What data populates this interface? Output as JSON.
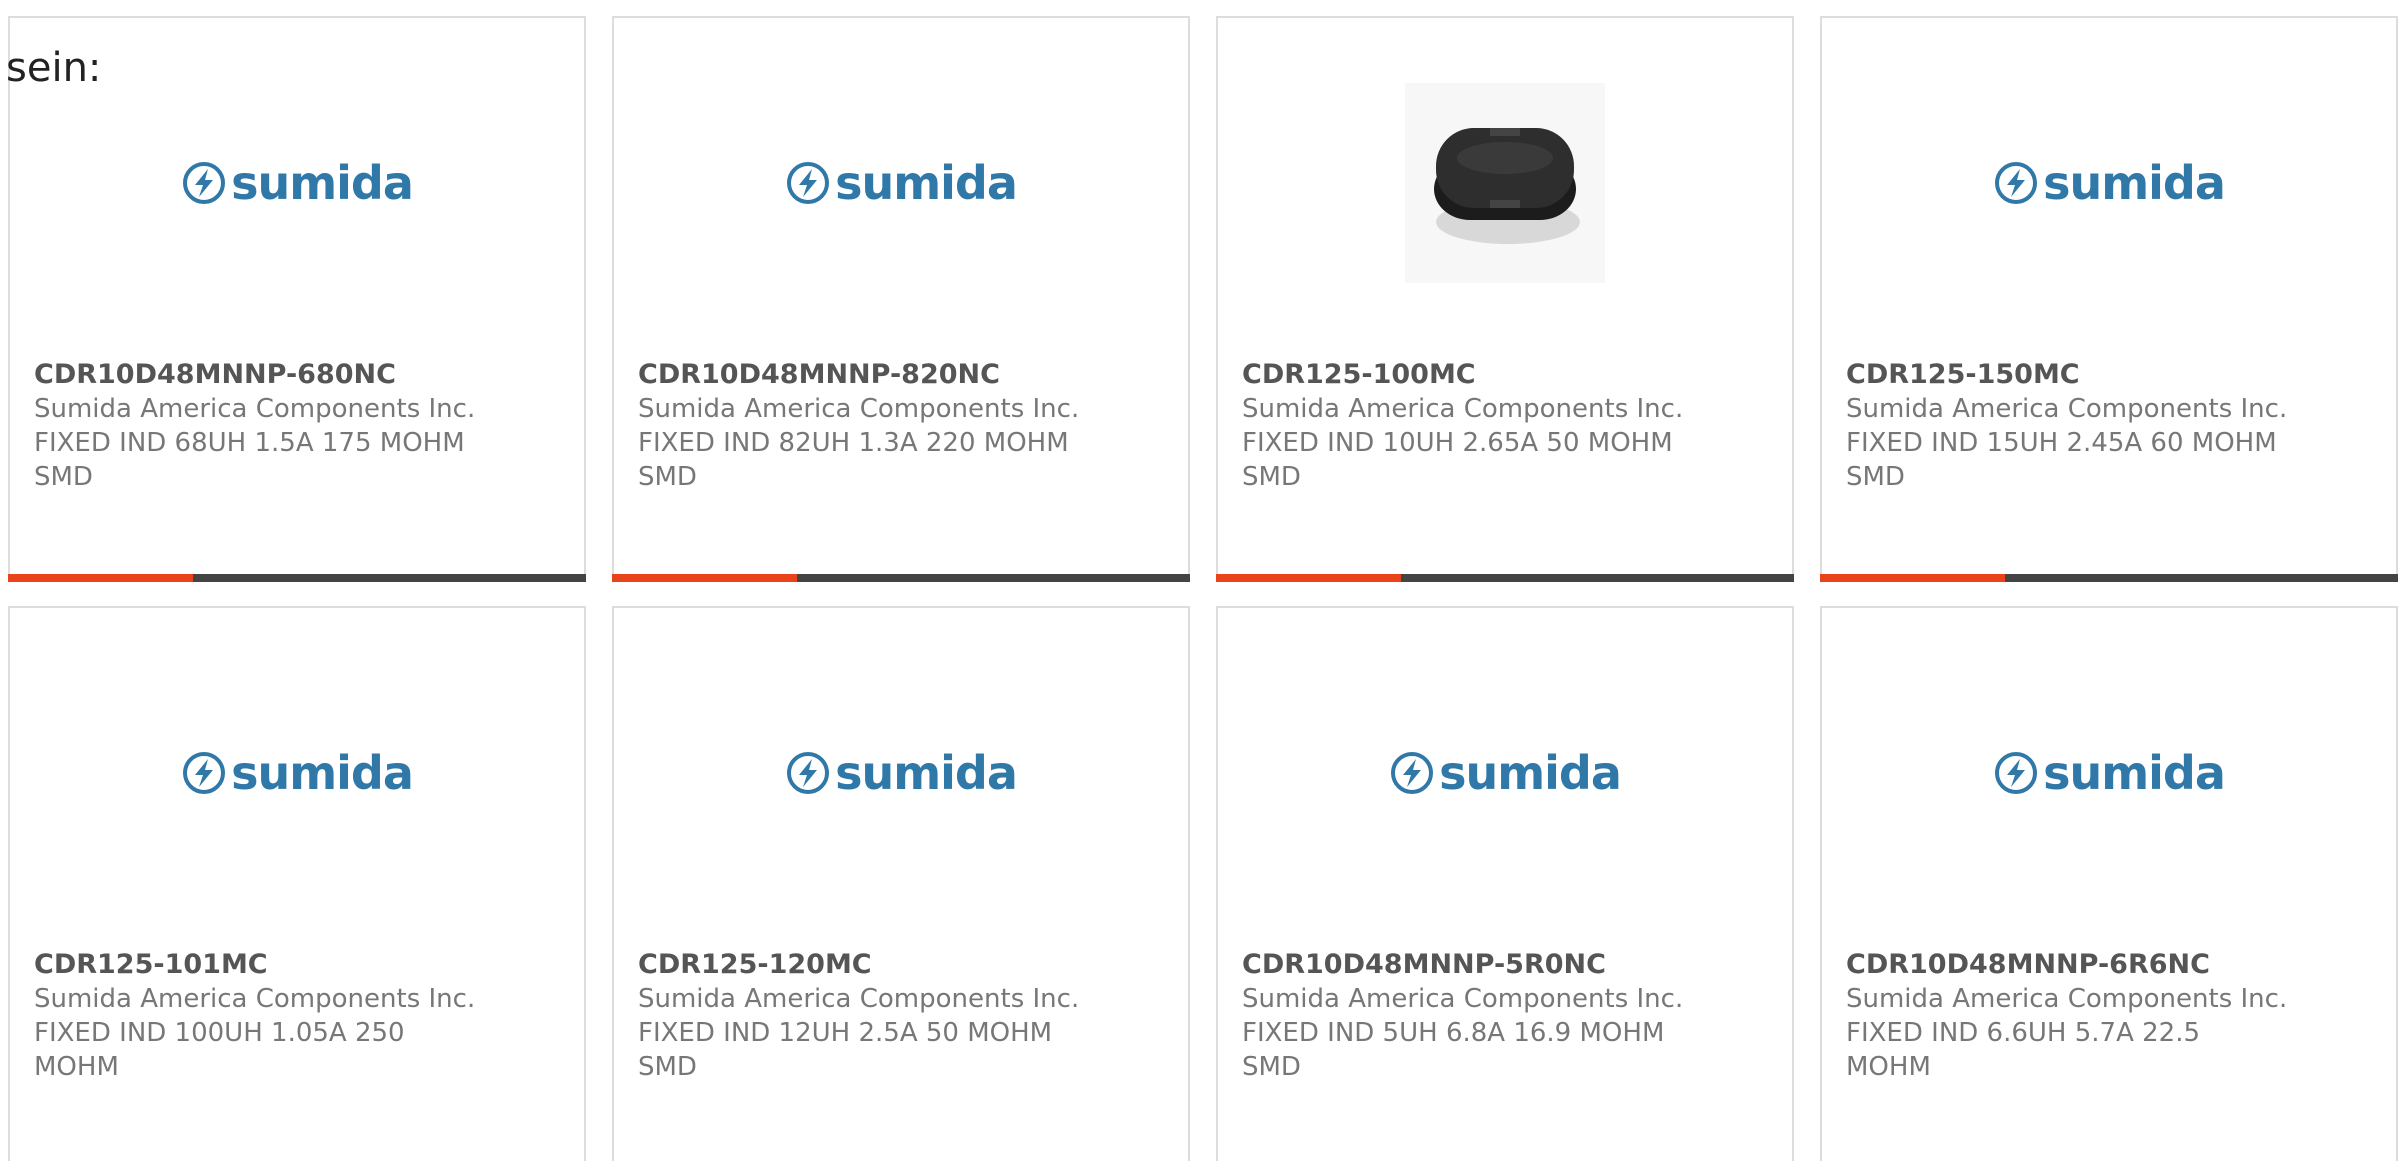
{
  "intro_text": "sein:",
  "accent_color": "#e8431b",
  "bar_color": "#444444",
  "logo_color": "#2f78a8",
  "cards": [
    {
      "part_number": "CDR10D48MNNP-680NC",
      "manufacturer": "Sumida America Components Inc.",
      "description": "FIXED IND 68UH 1.5A 175 MOHM SMD",
      "image": "sumida-logo",
      "logo_text": "sumida",
      "progress": 0.32
    },
    {
      "part_number": "CDR10D48MNNP-820NC",
      "manufacturer": "Sumida America Components Inc.",
      "description": "FIXED IND 82UH 1.3A 220 MOHM SMD",
      "image": "sumida-logo",
      "logo_text": "sumida",
      "progress": 0.32
    },
    {
      "part_number": "CDR125-100MC",
      "manufacturer": "Sumida America Components Inc.",
      "description": "FIXED IND 10UH 2.65A 50 MOHM SMD",
      "image": "inductor-photo",
      "logo_text": "",
      "progress": 0.32
    },
    {
      "part_number": "CDR125-150MC",
      "manufacturer": "Sumida America Components Inc.",
      "description": "FIXED IND 15UH 2.45A 60 MOHM SMD",
      "image": "sumida-logo",
      "logo_text": "sumida",
      "progress": 0.32
    },
    {
      "part_number": "CDR125-101MC",
      "manufacturer": "Sumida America Components Inc.",
      "description": "FIXED IND 100UH 1.05A 250 MOHM",
      "image": "sumida-logo",
      "logo_text": "sumida",
      "progress": null
    },
    {
      "part_number": "CDR125-120MC",
      "manufacturer": "Sumida America Components Inc.",
      "description": "FIXED IND 12UH 2.5A 50 MOHM SMD",
      "image": "sumida-logo",
      "logo_text": "sumida",
      "progress": null
    },
    {
      "part_number": "CDR10D48MNNP-5R0NC",
      "manufacturer": "Sumida America Components Inc.",
      "description": "FIXED IND 5UH 6.8A 16.9 MOHM SMD",
      "image": "sumida-logo",
      "logo_text": "sumida",
      "progress": null
    },
    {
      "part_number": "CDR10D48MNNP-6R6NC",
      "manufacturer": "Sumida America Components Inc.",
      "description": "FIXED IND 6.6UH 5.7A 22.5 MOHM",
      "image": "sumida-logo",
      "logo_text": "sumida",
      "progress": null
    }
  ]
}
